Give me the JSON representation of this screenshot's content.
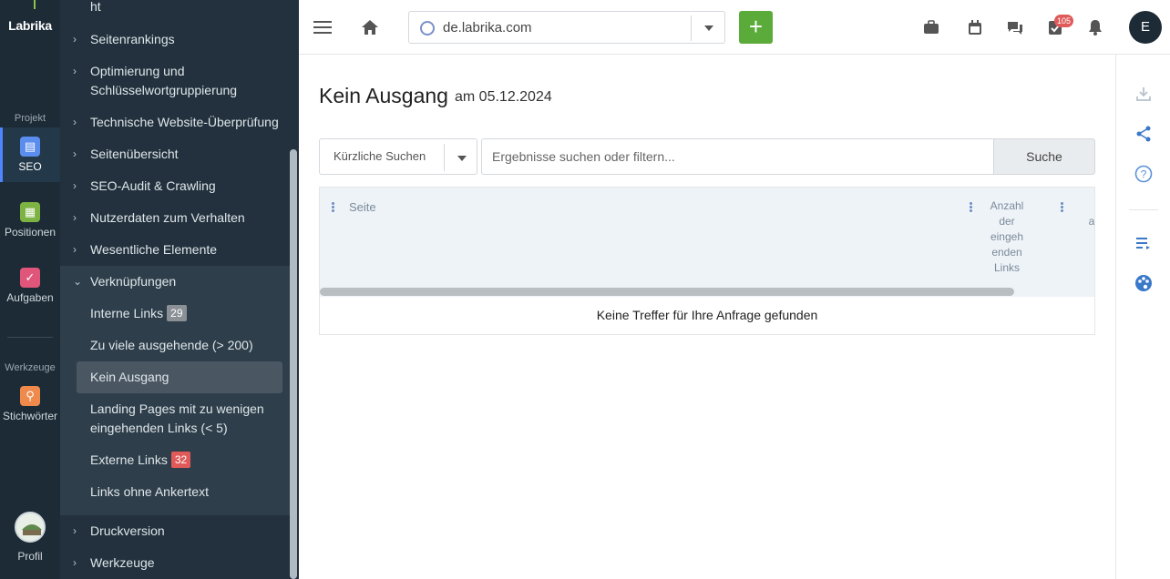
{
  "rail": {
    "logo": "Labrika",
    "section_project": "Projekt",
    "section_tools": "Werkzeuge",
    "items": [
      {
        "label": "SEO",
        "icon": "clipboard-icon",
        "color": "#5b8def"
      },
      {
        "label": "Positionen",
        "icon": "chart-icon",
        "color": "#7cb342"
      },
      {
        "label": "Aufgaben",
        "icon": "check-icon",
        "color": "#e0567a"
      },
      {
        "label": "Stichwörter",
        "icon": "key-icon",
        "color": "#ef8a4c"
      }
    ],
    "profile_label": "Profil"
  },
  "nav": {
    "top_cut": "ht",
    "items": [
      "Seitenrankings",
      "Optimierung und Schlüsselwortgruppierung",
      "Technische Website-Überprüfung",
      "Seitenübersicht",
      "SEO-Audit & Crawling",
      "Nutzerdaten zum Verhalten",
      "Wesentliche Elemente",
      "Verknüpfungen"
    ],
    "sub_items": [
      {
        "label": "Interne Links",
        "badge": "29",
        "badge_color": "#8a9096"
      },
      {
        "label": "Zu viele ausgehende (> 200)",
        "badge": null
      },
      {
        "label": "Kein Ausgang",
        "badge": null,
        "active": true
      },
      {
        "label": "Landing Pages mit zu wenigen eingehenden Links (< 5)",
        "badge": null
      },
      {
        "label": "Externe Links",
        "badge": "32",
        "badge_color": "#e05a5a"
      },
      {
        "label": "Links ohne Ankertext",
        "badge": null
      }
    ],
    "bottom_items": [
      "Druckversion",
      "Werkzeuge"
    ]
  },
  "topbar": {
    "domain": "de.labrika.com",
    "add_label": "+",
    "tasks_count": "105",
    "user_initial": "E"
  },
  "main": {
    "title": "Kein Ausgang",
    "date": "am 05.12.2024",
    "recent_search": "Kürzliche Suchen",
    "search_placeholder": "Ergebnisse suchen oder filtern...",
    "search_button": "Suche",
    "columns": [
      "Seite",
      "Anzahl der eingeh enden Links",
      "a"
    ],
    "empty_message": "Keine Treffer für Ihre Anfrage gefunden"
  },
  "right_rail": {
    "icons": [
      "download-icon",
      "share-icon",
      "help-icon",
      "list-icon",
      "palette-icon"
    ]
  }
}
